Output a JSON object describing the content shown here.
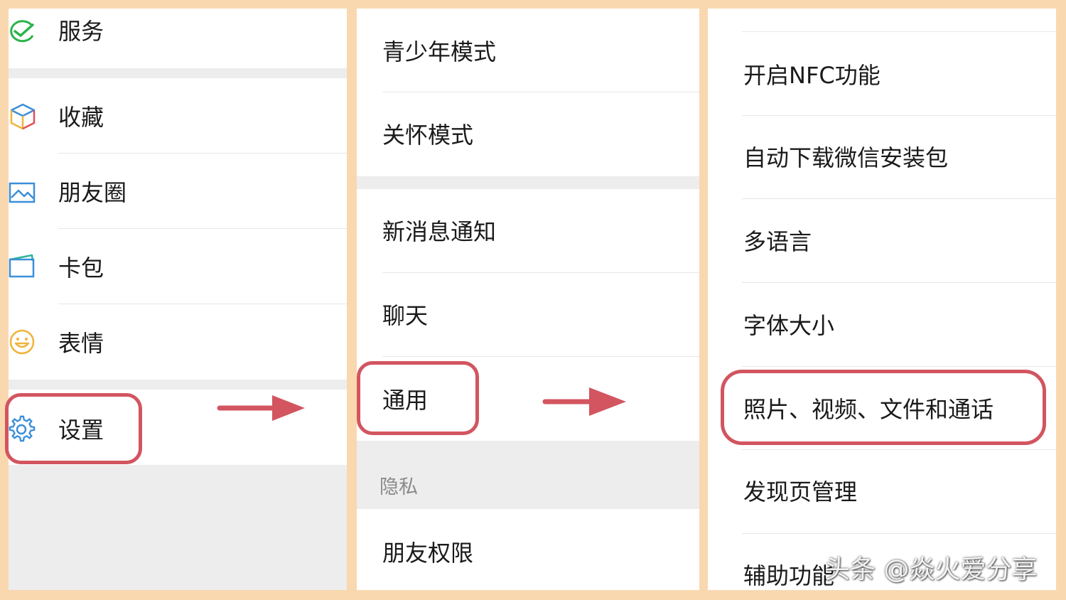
{
  "panel1": {
    "items": [
      {
        "label": "服务",
        "icon": "wechat-pay-icon"
      },
      {
        "label": "收藏",
        "icon": "favorites-cube-icon"
      },
      {
        "label": "朋友圈",
        "icon": "moments-picture-icon"
      },
      {
        "label": "卡包",
        "icon": "card-wallet-icon"
      },
      {
        "label": "表情",
        "icon": "smiley-icon"
      },
      {
        "label": "设置",
        "icon": "gear-icon"
      }
    ]
  },
  "panel2": {
    "items": [
      "青少年模式",
      "关怀模式",
      "新消息通知",
      "聊天",
      "通用"
    ],
    "section_title": "隐私",
    "privacy_item": "朋友权限"
  },
  "panel3": {
    "items": [
      "开启NFC功能",
      "自动下载微信安装包",
      "多语言",
      "字体大小",
      "照片、视频、文件和通话",
      "发现页管理",
      "辅助功能"
    ]
  },
  "watermark": "头条 @焱火爱分享",
  "colors": {
    "highlight": "#d2555f",
    "background": "#f9d8b0",
    "section_gray": "#ededed"
  }
}
